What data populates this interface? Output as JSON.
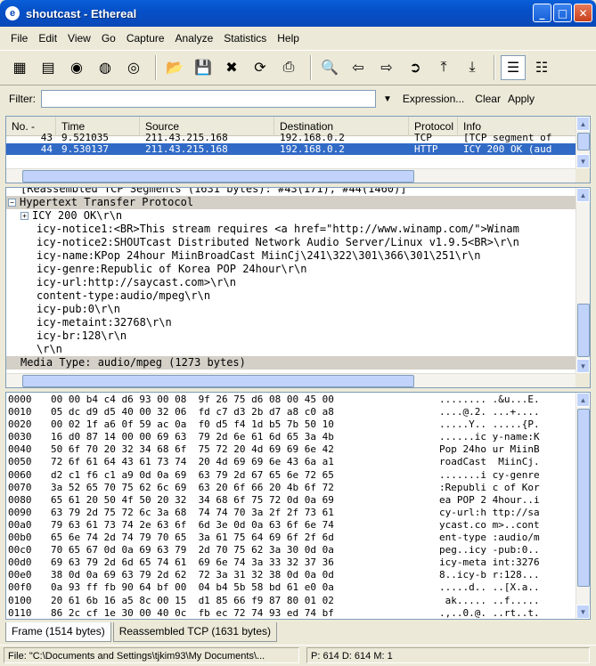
{
  "window": {
    "title": "shoutcast - Ethereal",
    "icon": "ethereal-app-icon"
  },
  "menu": [
    "File",
    "Edit",
    "View",
    "Go",
    "Capture",
    "Analyze",
    "Statistics",
    "Help"
  ],
  "filter": {
    "label": "Filter:",
    "value": "",
    "expression_label": "Expression...",
    "clear_label": "Clear",
    "apply_label": "Apply"
  },
  "packet_list": {
    "columns": [
      "No. -",
      "Time",
      "Source",
      "Destination",
      "Protocol",
      "Info"
    ],
    "rows": [
      {
        "no": "43",
        "time": "9.521035",
        "source": "211.43.215.168",
        "destination": "192.168.0.2",
        "protocol": "TCP",
        "info": "[TCP segment of"
      },
      {
        "no": "44",
        "time": "9.530137",
        "source": "211.43.215.168",
        "destination": "192.168.0.2",
        "protocol": "HTTP",
        "info": "ICY 200 OK (aud"
      }
    ]
  },
  "details": {
    "lines": [
      "[Reassembled TCP Segments (1631 bytes): #43(171), #44(1460)]",
      "Hypertext Transfer Protocol",
      "ICY 200 OK\\r\\n",
      "icy-notice1:<BR>This stream requires <a href=\"http://www.winamp.com/\">Winam",
      "icy-notice2:SHOUTcast Distributed Network Audio Server/Linux v1.9.5<BR>\\r\\n",
      "icy-name:KPop 24hour MiinBroadCast MiinCj\\241\\322\\301\\366\\301\\251\\r\\n",
      "icy-genre:Republic of Korea POP 24hour\\r\\n",
      "icy-url:http://saycast.com>\\r\\n",
      "content-type:audio/mpeg\\r\\n",
      "icy-pub:0\\r\\n",
      "icy-metaint:32768\\r\\n",
      "icy-br:128\\r\\n",
      "\\r\\n",
      "Media Type: audio/mpeg (1273 bytes)"
    ]
  },
  "hex": {
    "rows": [
      [
        "0000",
        "00 00 b4 c4 d6 93 00 08  9f 26 75 d6 08 00 45 00",
        "........ .&u...E."
      ],
      [
        "0010",
        "05 dc d9 d5 40 00 32 06  fd c7 d3 2b d7 a8 c0 a8",
        "....@.2. ...+...."
      ],
      [
        "0020",
        "00 02 1f a6 0f 59 ac 0a  f0 d5 f4 1d b5 7b 50 10",
        ".....Y.. .....{P."
      ],
      [
        "0030",
        "16 d0 87 14 00 00 69 63  79 2d 6e 61 6d 65 3a 4b",
        "......ic y-name:K"
      ],
      [
        "0040",
        "50 6f 70 20 32 34 68 6f  75 72 20 4d 69 69 6e 42",
        "Pop 24ho ur MiinB"
      ],
      [
        "0050",
        "72 6f 61 64 43 61 73 74  20 4d 69 69 6e 43 6a a1",
        "roadCast  MiinCj."
      ],
      [
        "0060",
        "d2 c1 f6 c1 a9 0d 0a 69  63 79 2d 67 65 6e 72 65",
        ".......i cy-genre"
      ],
      [
        "0070",
        "3a 52 65 70 75 62 6c 69  63 20 6f 66 20 4b 6f 72",
        ":Republi c of Kor"
      ],
      [
        "0080",
        "65 61 20 50 4f 50 20 32  34 68 6f 75 72 0d 0a 69",
        "ea POP 2 4hour..i"
      ],
      [
        "0090",
        "63 79 2d 75 72 6c 3a 68  74 74 70 3a 2f 2f 73 61",
        "cy-url:h ttp://sa"
      ],
      [
        "00a0",
        "79 63 61 73 74 2e 63 6f  6d 3e 0d 0a 63 6f 6e 74",
        "ycast.co m>..cont"
      ],
      [
        "00b0",
        "65 6e 74 2d 74 79 70 65  3a 61 75 64 69 6f 2f 6d",
        "ent-type :audio/m"
      ],
      [
        "00c0",
        "70 65 67 0d 0a 69 63 79  2d 70 75 62 3a 30 0d 0a",
        "peg..icy -pub:0.."
      ],
      [
        "00d0",
        "69 63 79 2d 6d 65 74 61  69 6e 74 3a 33 32 37 36",
        "icy-meta int:3276"
      ],
      [
        "00e0",
        "38 0d 0a 69 63 79 2d 62  72 3a 31 32 38 0d 0a 0d",
        "8..icy-b r:128..."
      ],
      [
        "00f0",
        "0a 93 ff fb 90 64 bf 00  04 b4 5b 58 bd 61 e0 0a",
        ".....d.. ..[X.a.."
      ],
      [
        "0100",
        "20 61 6b 16 a5 8c 00 15  d1 85 66 f9 87 80 01 02",
        " ak..... ..f....."
      ],
      [
        "0110",
        "86 2c cf 1e 30 00 40 0c  fb ec 72 74 93 ed 74 bf",
        ".,..0.@. ..rt..t."
      ],
      [
        "0120",
        "f4 03 ee ff a8 e7 df a1  a3 cf 9c 28 5c 81 a3 fe",
        "........ ...(\\..."
      ],
      [
        "0130",
        "00 27 01 d0 e8 16 ca 6f  0e 8e 0b 0f c9 8b e3 80",
        ".'.....o ........"
      ]
    ]
  },
  "tabs": [
    "Frame (1514 bytes)",
    "Reassembled TCP (1631 bytes)"
  ],
  "status": {
    "file": "File: \"C:\\Documents and Settings\\tjkim93\\My Documents\\...",
    "packets": "P: 614 D: 614 M: 1"
  }
}
